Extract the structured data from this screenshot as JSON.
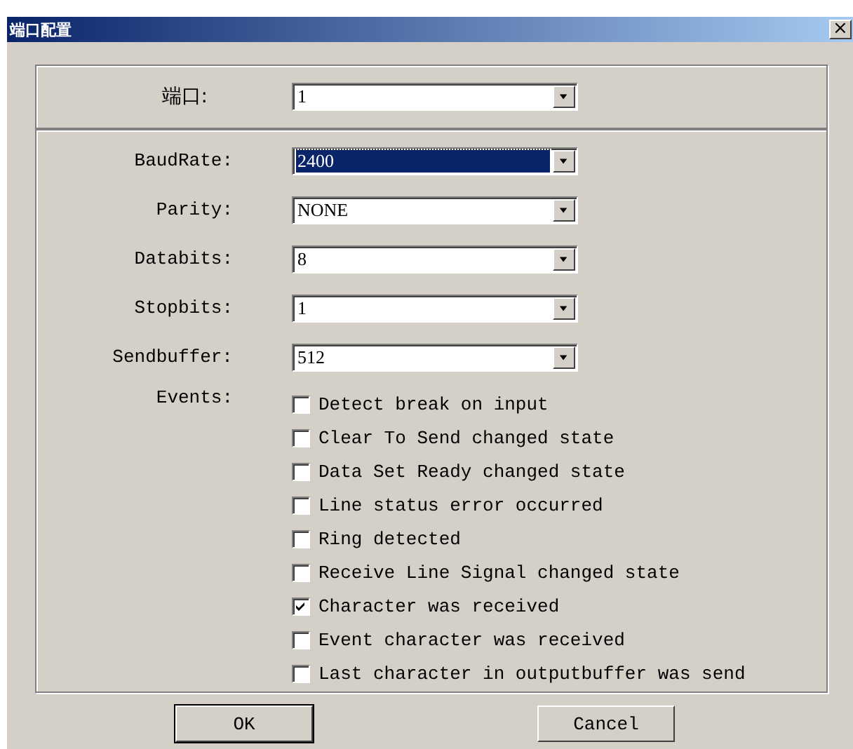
{
  "window": {
    "title": "端口配置",
    "close": "×"
  },
  "port": {
    "label": "端口:",
    "value": "1"
  },
  "settings": [
    {
      "label": "BaudRate:",
      "value": "2400",
      "selected": true
    },
    {
      "label": "Parity:",
      "value": "NONE",
      "selected": false
    },
    {
      "label": "Databits:",
      "value": "8",
      "selected": false
    },
    {
      "label": "Stopbits:",
      "value": "1",
      "selected": false
    },
    {
      "label": "Sendbuffer:",
      "value": "512",
      "selected": false
    }
  ],
  "events": {
    "label": "Events:",
    "options": [
      {
        "label": "Detect break on input",
        "checked": false
      },
      {
        "label": "Clear To Send changed state",
        "checked": false
      },
      {
        "label": "Data Set Ready changed state",
        "checked": false
      },
      {
        "label": "Line status error occurred",
        "checked": false
      },
      {
        "label": "Ring detected",
        "checked": false
      },
      {
        "label": "Receive Line Signal changed state",
        "checked": false
      },
      {
        "label": "Character was received",
        "checked": true
      },
      {
        "label": "Event character was received",
        "checked": false
      },
      {
        "label": "Last character in outputbuffer was send",
        "checked": false
      }
    ]
  },
  "buttons": [
    {
      "label": "OK",
      "default": true
    },
    {
      "label": "Cancel",
      "default": false
    }
  ]
}
